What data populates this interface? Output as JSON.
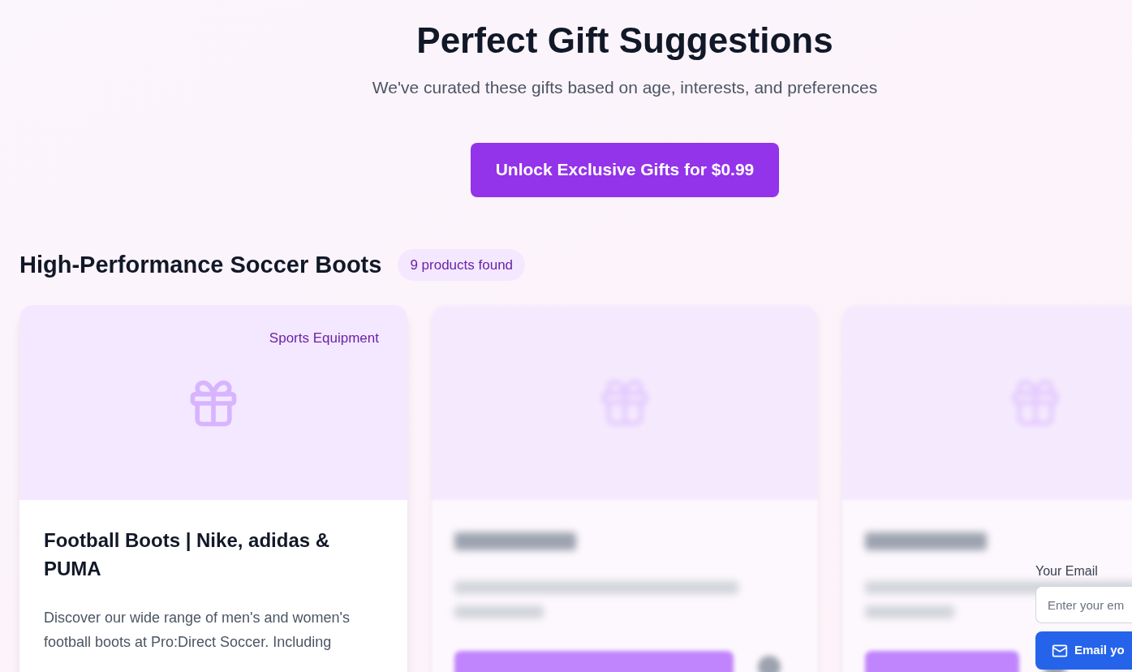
{
  "header": {
    "title": "Perfect Gift Suggestions",
    "subtitle": "We've curated these gifts based on age, interests, and preferences",
    "unlock_button": "Unlock Exclusive Gifts for $0.99"
  },
  "section": {
    "title": "High-Performance Soccer Boots",
    "count_badge": "9 products found"
  },
  "products": [
    {
      "kind": "unlocked",
      "category": "Sports Equipment",
      "title": "Football Boots | Nike, adidas & PUMA",
      "description": "Discover our wide range of men's and women's football boots at Pro:Direct Soccer. Including"
    },
    {
      "kind": "locked"
    },
    {
      "kind": "locked"
    }
  ],
  "email_form": {
    "label": "Your Email",
    "placeholder": "Enter your em",
    "button": "Email yo"
  }
}
